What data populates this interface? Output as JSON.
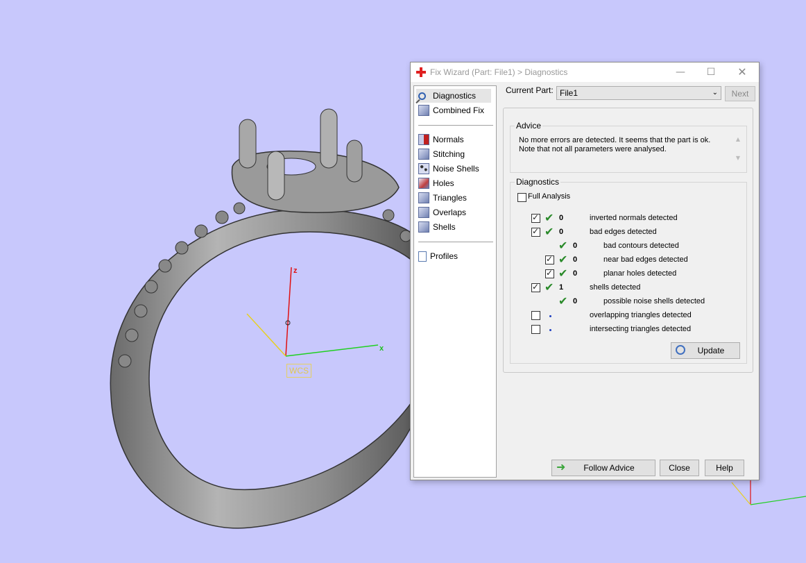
{
  "viewport": {
    "axis_z": "z",
    "axis_x": "x",
    "wcs_label": "WCS"
  },
  "dialog": {
    "title": "Fix Wizard (Part: File1) > Diagnostics",
    "nav": {
      "top_items": [
        {
          "label": "Diagnostics",
          "icon": "magnifier-icon",
          "selected": true
        },
        {
          "label": "Combined Fix",
          "icon": "cube-icon"
        }
      ],
      "fix_items": [
        {
          "label": "Normals",
          "icon": "normals-cube-icon"
        },
        {
          "label": "Stitching",
          "icon": "stitching-cube-icon"
        },
        {
          "label": "Noise Shells",
          "icon": "noise-shells-cube-icon"
        },
        {
          "label": "Holes",
          "icon": "holes-cube-icon"
        },
        {
          "label": "Triangles",
          "icon": "triangles-cube-icon"
        },
        {
          "label": "Overlaps",
          "icon": "overlaps-cube-icon"
        },
        {
          "label": "Shells",
          "icon": "shells-cube-icon"
        }
      ],
      "bottom_items": [
        {
          "label": "Profiles",
          "icon": "document-icon"
        }
      ]
    },
    "current_part_label": "Current Part:",
    "current_part_value": "File1",
    "next_label": "Next",
    "advice": {
      "title": "Advice",
      "line1": "No more errors are detected. It seems that the part is ok.",
      "line2": "Note that not all parameters were analysed."
    },
    "diagnostics": {
      "title": "Diagnostics",
      "full_analysis_label": "Full Analysis",
      "full_analysis_checked": false,
      "rows": [
        {
          "checked": true,
          "status": "ok",
          "count": "0",
          "label": "inverted normals detected",
          "indent": 0
        },
        {
          "checked": true,
          "status": "ok",
          "count": "0",
          "label": "bad edges detected",
          "indent": 0
        },
        {
          "checked": null,
          "status": "ok",
          "count": "0",
          "label": "bad contours detected",
          "indent": 1
        },
        {
          "checked": true,
          "status": "ok",
          "count": "0",
          "label": "near bad edges detected",
          "indent": 1
        },
        {
          "checked": true,
          "status": "ok",
          "count": "0",
          "label": "planar holes detected",
          "indent": 1
        },
        {
          "checked": true,
          "status": "ok",
          "count": "1",
          "label": "shells detected",
          "indent": 0
        },
        {
          "checked": null,
          "status": "ok",
          "count": "0",
          "label": "possible noise shells detected",
          "indent": 1
        },
        {
          "checked": false,
          "status": "pending",
          "count": "",
          "label": "overlapping triangles detected",
          "indent": 0
        },
        {
          "checked": false,
          "status": "pending",
          "count": "",
          "label": "intersecting triangles detected",
          "indent": 0
        }
      ],
      "update_label": "Update"
    },
    "buttons": {
      "follow_advice": "Follow Advice",
      "close": "Close",
      "help": "Help"
    }
  }
}
